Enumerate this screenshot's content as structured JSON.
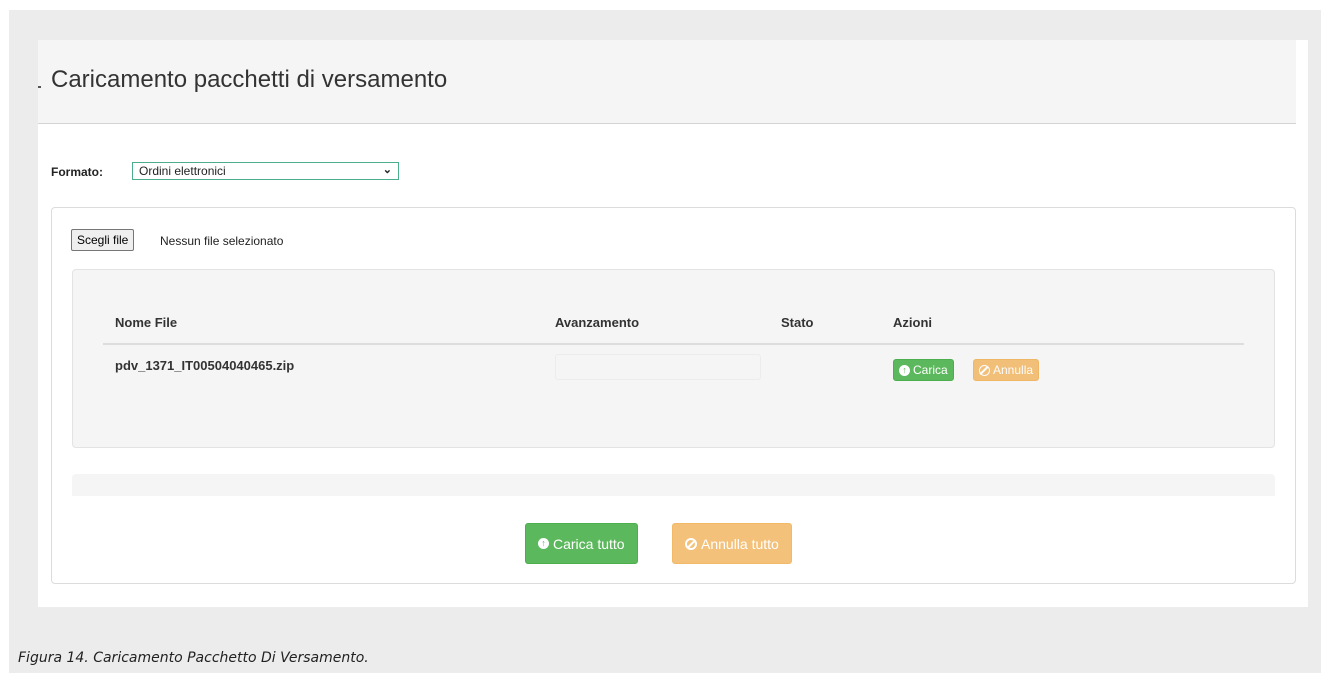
{
  "header": {
    "title": "Caricamento pacchetti di versamento"
  },
  "formato": {
    "label": "Formato:",
    "selected": "Ordini elettronici"
  },
  "file_input": {
    "button_label": "Scegli file",
    "status": "Nessun file selezionato"
  },
  "table": {
    "columns": [
      "Nome File",
      "Avanzamento",
      "Stato",
      "Azioni"
    ],
    "rows": [
      {
        "name": "pdv_1371_IT00504040465.zip",
        "stato": "",
        "progress": 0
      }
    ],
    "row_actions": {
      "upload_label": "Carica",
      "cancel_label": "Annulla"
    }
  },
  "footer_actions": {
    "upload_all_label": "Carica tutto",
    "cancel_all_label": "Annulla tutto"
  },
  "caption": "Figura 14. Caricamento Pacchetto Di Versamento.",
  "colors": {
    "success": "#5cb85c",
    "warning": "#f0ad4e",
    "select_border": "#4caf8c"
  },
  "icons": {
    "upload": "circle-arrow-up-icon",
    "cancel": "ban-icon",
    "dropdown": "chevron-down-icon"
  }
}
